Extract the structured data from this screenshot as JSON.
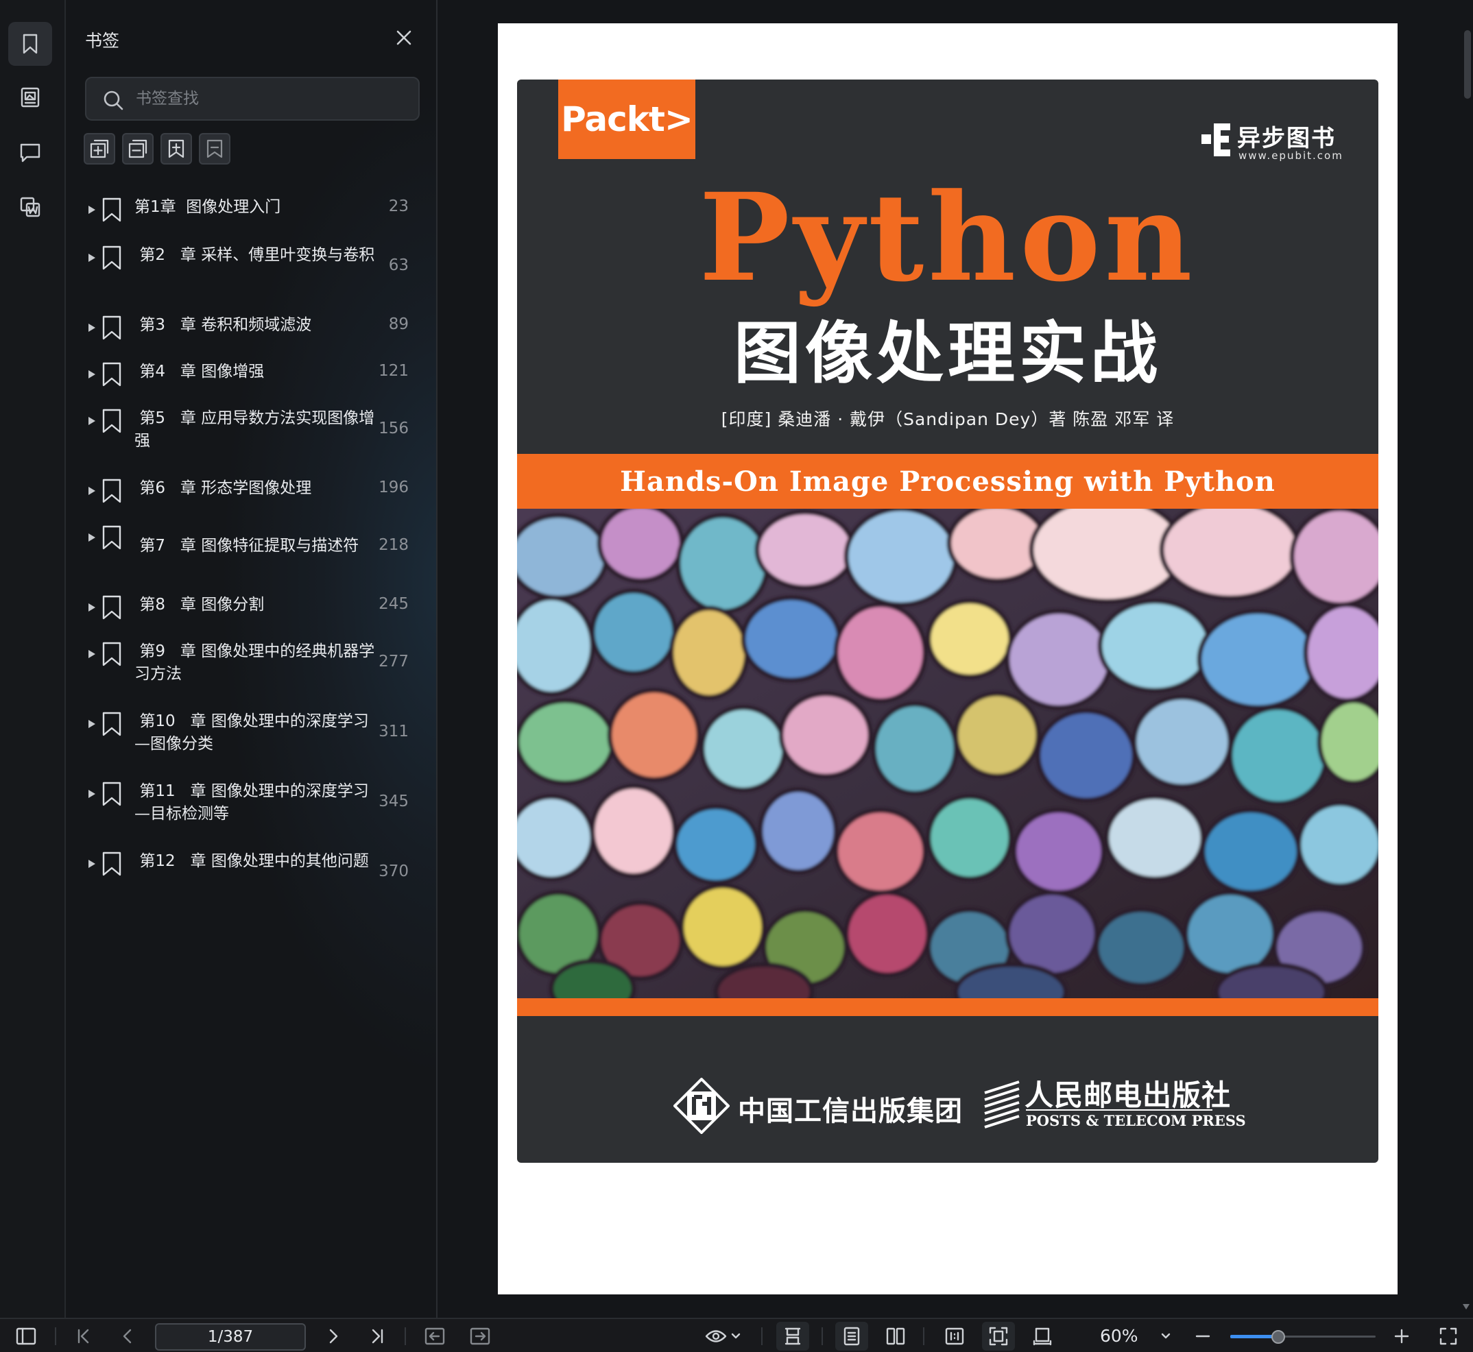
{
  "rail": {
    "items": [
      {
        "icon": "bookmark-icon",
        "active": true
      },
      {
        "icon": "thumbnail-icon",
        "active": false
      },
      {
        "icon": "comment-icon",
        "active": false
      },
      {
        "icon": "convert-word-icon",
        "active": false
      }
    ]
  },
  "bookmarks_panel": {
    "title": "书签",
    "search_placeholder": "书签查找",
    "tools": [
      "add-bookmark-icon",
      "remove-bookmark-icon",
      "expand-bookmark-icon",
      "collapse-bookmark-icon"
    ],
    "items": [
      {
        "label": "第1章  图像处理入门",
        "page": "23"
      },
      {
        "label": " 第2   章 采样、傅里叶变换与卷积",
        "page": "63"
      },
      {
        "label": " 第3   章 卷积和频域滤波",
        "page": "89"
      },
      {
        "label": " 第4   章 图像增强",
        "page": "121"
      },
      {
        "label": " 第5   章 应用导数方法实现图像增强",
        "page": "156"
      },
      {
        "label": " 第6   章 形态学图像处理",
        "page": "196"
      },
      {
        "label": " 第7   章 图像特征提取与描述符",
        "page": "218"
      },
      {
        "label": " 第8   章 图像分割",
        "page": "245"
      },
      {
        "label": " 第9   章 图像处理中的经典机器学习方法",
        "page": "277"
      },
      {
        "label": " 第10   章 图像处理中的深度学习—图像分类",
        "page": "311"
      },
      {
        "label": " 第11   章 图像处理中的深度学习—目标检测等",
        "page": "345"
      },
      {
        "label": " 第12   章 图像处理中的其他问题",
        "page": "370"
      }
    ]
  },
  "cover": {
    "publisher_logo": "Packt>",
    "imprint_name": "异步图书",
    "imprint_url": "www.epubit.com",
    "title_en": "Python",
    "title_cn": "图像处理实战",
    "authors": "[印度] 桑迪潘 · 戴伊（Sandipan Dey）著     陈盈 邓军 译",
    "subtitle_en": "Hands-On Image Processing with Python",
    "publisher1": "中国工信出版集团",
    "publisher2_cn": "人民邮电出版社",
    "publisher2_en": "POSTS & TELECOM PRESS",
    "colors": {
      "accent": "#f26b21",
      "cover_bg": "#2e3033"
    }
  },
  "toolbar": {
    "page_indicator": "1/387",
    "zoom_level": "60%",
    "zoom_slider_fraction": 0.33
  }
}
